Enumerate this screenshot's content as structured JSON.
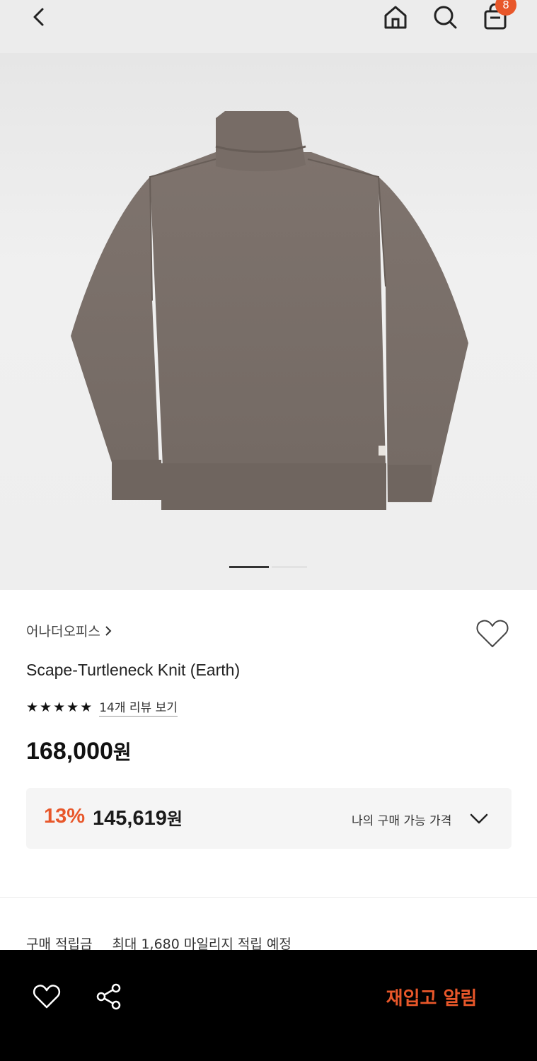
{
  "header": {
    "cart_count": "8"
  },
  "product": {
    "brand": "어나더오피스",
    "name": "Scape-Turtleneck Knit (Earth)",
    "rating_stars": 5,
    "review_link": "14개 리뷰 보기",
    "price": "168,000",
    "price_unit": "원"
  },
  "my_price": {
    "discount": "13%",
    "price": "145,619",
    "price_unit": "원",
    "label": "나의 구매 가능 가격"
  },
  "points": {
    "label": "구매 적립금",
    "value": "최대 1,680 마일리지 적립 예정"
  },
  "bottom_bar": {
    "restock_label": "재입고 알림"
  },
  "gallery": {
    "current_index": 1,
    "total": 2
  },
  "colors": {
    "accent": "#e8572a",
    "sweater": "#7b706a"
  }
}
